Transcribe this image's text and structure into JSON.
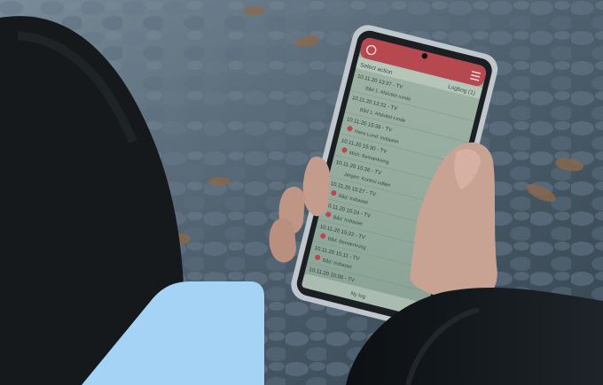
{
  "photo": {
    "description_free": true
  },
  "phone_app": {
    "header_left": "Select action",
    "header_right": "Logbog (1)",
    "rows": [
      {
        "time": "10.11.20 13:37 - TV",
        "detail": "Båd 1: Afsluttet runde"
      },
      {
        "time": "10.11.20 13:31 - TV",
        "detail": "Båd 1: Afsluttet runde"
      },
      {
        "time": "10.11.20 15:36 - TV",
        "detail": "Hans Lund: Indtastet"
      },
      {
        "time": "10.11.20 15:30 - TV",
        "detail": "Mich: Bemærkning"
      },
      {
        "time": "10.11.20 15:26 - TV",
        "detail": "Jørgen: Kontrol udført"
      },
      {
        "time": "10.11.20 15:27 - TV",
        "detail": "Båd: Indtastet"
      },
      {
        "time": "10.11.20 15:24 - TV",
        "detail": "Båd: Indtastet"
      },
      {
        "time": "10.11.20 15:22 - TV",
        "detail": "Båd: Bemærkning"
      },
      {
        "time": "10.11.20 15:11 - TV",
        "detail": "Båd: Indtastet"
      },
      {
        "time": "10.11.20 15:06 - TV",
        "detail": ""
      }
    ],
    "footer_button": "Ny log"
  },
  "colors": {
    "app_accent": "#b6484f",
    "overlay_shape": "#a4d3f5"
  }
}
